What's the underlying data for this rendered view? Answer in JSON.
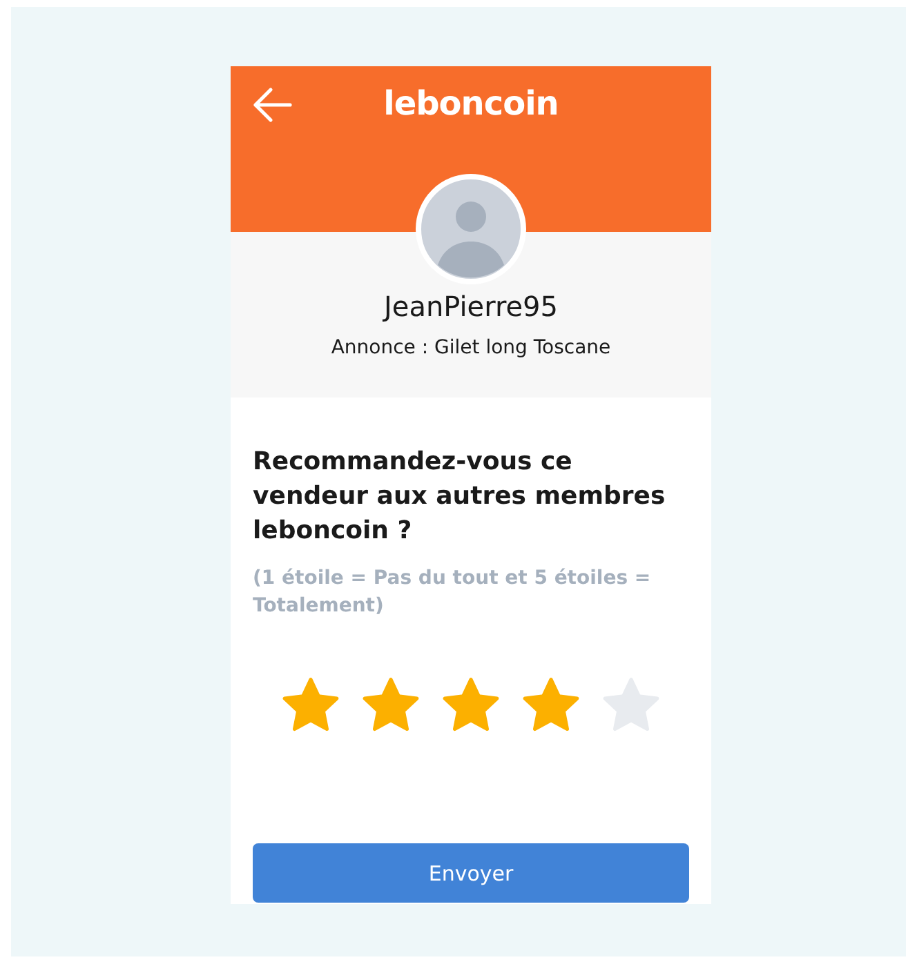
{
  "header": {
    "logo": "leboncoin"
  },
  "profile": {
    "username": "JeanPierre95",
    "listing": "Annonce : Gilet long Toscane"
  },
  "question": "Recommandez-vous ce vendeur aux autres membres leboncoin ?",
  "hint": "(1 étoile = Pas du tout et 5 étoiles = Totalement)",
  "rating": {
    "stars": 4
  },
  "submit_button": "Envoyer"
}
